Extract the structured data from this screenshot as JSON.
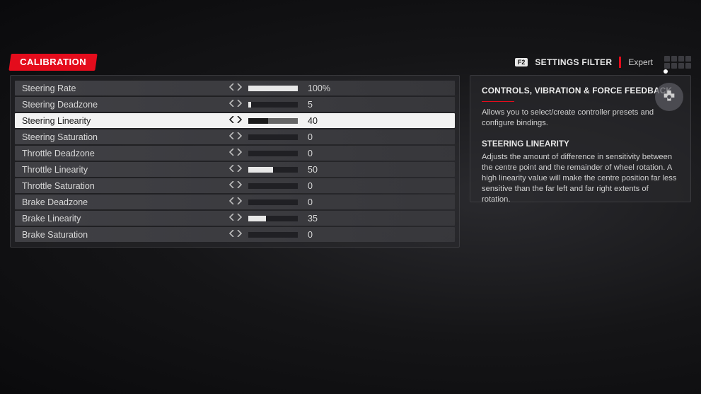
{
  "header": {
    "title": "CALIBRATION",
    "filter_key": "F2",
    "filter_label": "SETTINGS FILTER",
    "filter_value": "Expert"
  },
  "settings": [
    {
      "label": "Steering Rate",
      "value": 100,
      "display": "100%",
      "selected": false
    },
    {
      "label": "Steering Deadzone",
      "value": 5,
      "display": "5",
      "selected": false
    },
    {
      "label": "Steering Linearity",
      "value": 40,
      "display": "40",
      "selected": true
    },
    {
      "label": "Steering Saturation",
      "value": 0,
      "display": "0",
      "selected": false
    },
    {
      "label": "Throttle Deadzone",
      "value": 0,
      "display": "0",
      "selected": false
    },
    {
      "label": "Throttle Linearity",
      "value": 50,
      "display": "50",
      "selected": false
    },
    {
      "label": "Throttle Saturation",
      "value": 0,
      "display": "0",
      "selected": false
    },
    {
      "label": "Brake Deadzone",
      "value": 0,
      "display": "0",
      "selected": false
    },
    {
      "label": "Brake Linearity",
      "value": 35,
      "display": "35",
      "selected": false
    },
    {
      "label": "Brake Saturation",
      "value": 0,
      "display": "0",
      "selected": false
    }
  ],
  "info": {
    "section_title": "CONTROLS, VIBRATION & FORCE FEEDBACK",
    "section_desc": "Allows you to select/create controller presets and configure bindings.",
    "sub_title": "STEERING LINEARITY",
    "sub_desc": "Adjusts the amount of difference in sensitivity between the centre point and the remainder of wheel rotation. A high linearity value will make the centre position far less sensitive than the far left and far right extents of rotation."
  },
  "colors": {
    "accent": "#e40c1c"
  }
}
